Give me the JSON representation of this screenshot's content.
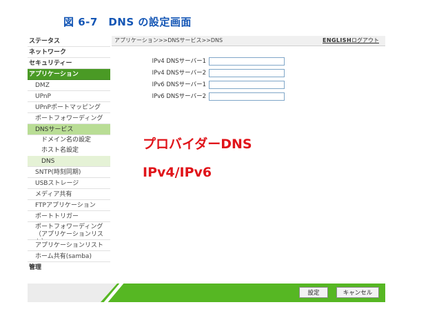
{
  "caption": "図 6-7　DNS の設定画面",
  "sidebar": {
    "items": [
      {
        "label": "ステータス"
      },
      {
        "label": "ネットワーク"
      },
      {
        "label": "セキュリティー"
      },
      {
        "label": "アプリケーション"
      },
      {
        "label": "DMZ"
      },
      {
        "label": "UPnP"
      },
      {
        "label": "UPnPポートマッピング"
      },
      {
        "label": "ポートフォワーディング"
      },
      {
        "label": "DNSサービス"
      },
      {
        "label": "ドメイン名の設定"
      },
      {
        "label": "ホスト名設定"
      },
      {
        "label": "DNS"
      },
      {
        "label": "SNTP(時刻同期)"
      },
      {
        "label": "USBストレージ"
      },
      {
        "label": "メディア共有"
      },
      {
        "label": "FTPアプリケーション"
      },
      {
        "label": "ポートトリガー"
      },
      {
        "label": "ポートフォワーディング（アプリケーションリスト）"
      },
      {
        "label": "アプリケーションリスト"
      },
      {
        "label": "ホーム共有(samba)"
      },
      {
        "label": "管理"
      }
    ]
  },
  "header": {
    "breadcrumb": "アプリケーション>>DNSサービス>>DNS",
    "lang_link": "ENGLISH",
    "logout_link": "ログアウト"
  },
  "form": {
    "fields": [
      {
        "label": "IPv4 DNSサーバー1",
        "value": ""
      },
      {
        "label": "IPv4 DNSサーバー2",
        "value": ""
      },
      {
        "label": "IPv6 DNSサーバー1",
        "value": ""
      },
      {
        "label": "IPv6 DNSサーバー2",
        "value": ""
      }
    ]
  },
  "annotations": {
    "line1": "プロバイダーDNS",
    "line2": "IPv4/IPv6",
    "color": "#e0141a"
  },
  "footer": {
    "save_label": "設定",
    "cancel_label": "キャンセル"
  },
  "colors": {
    "accent_green": "#4a9a25",
    "caption_blue": "#1456b5"
  }
}
